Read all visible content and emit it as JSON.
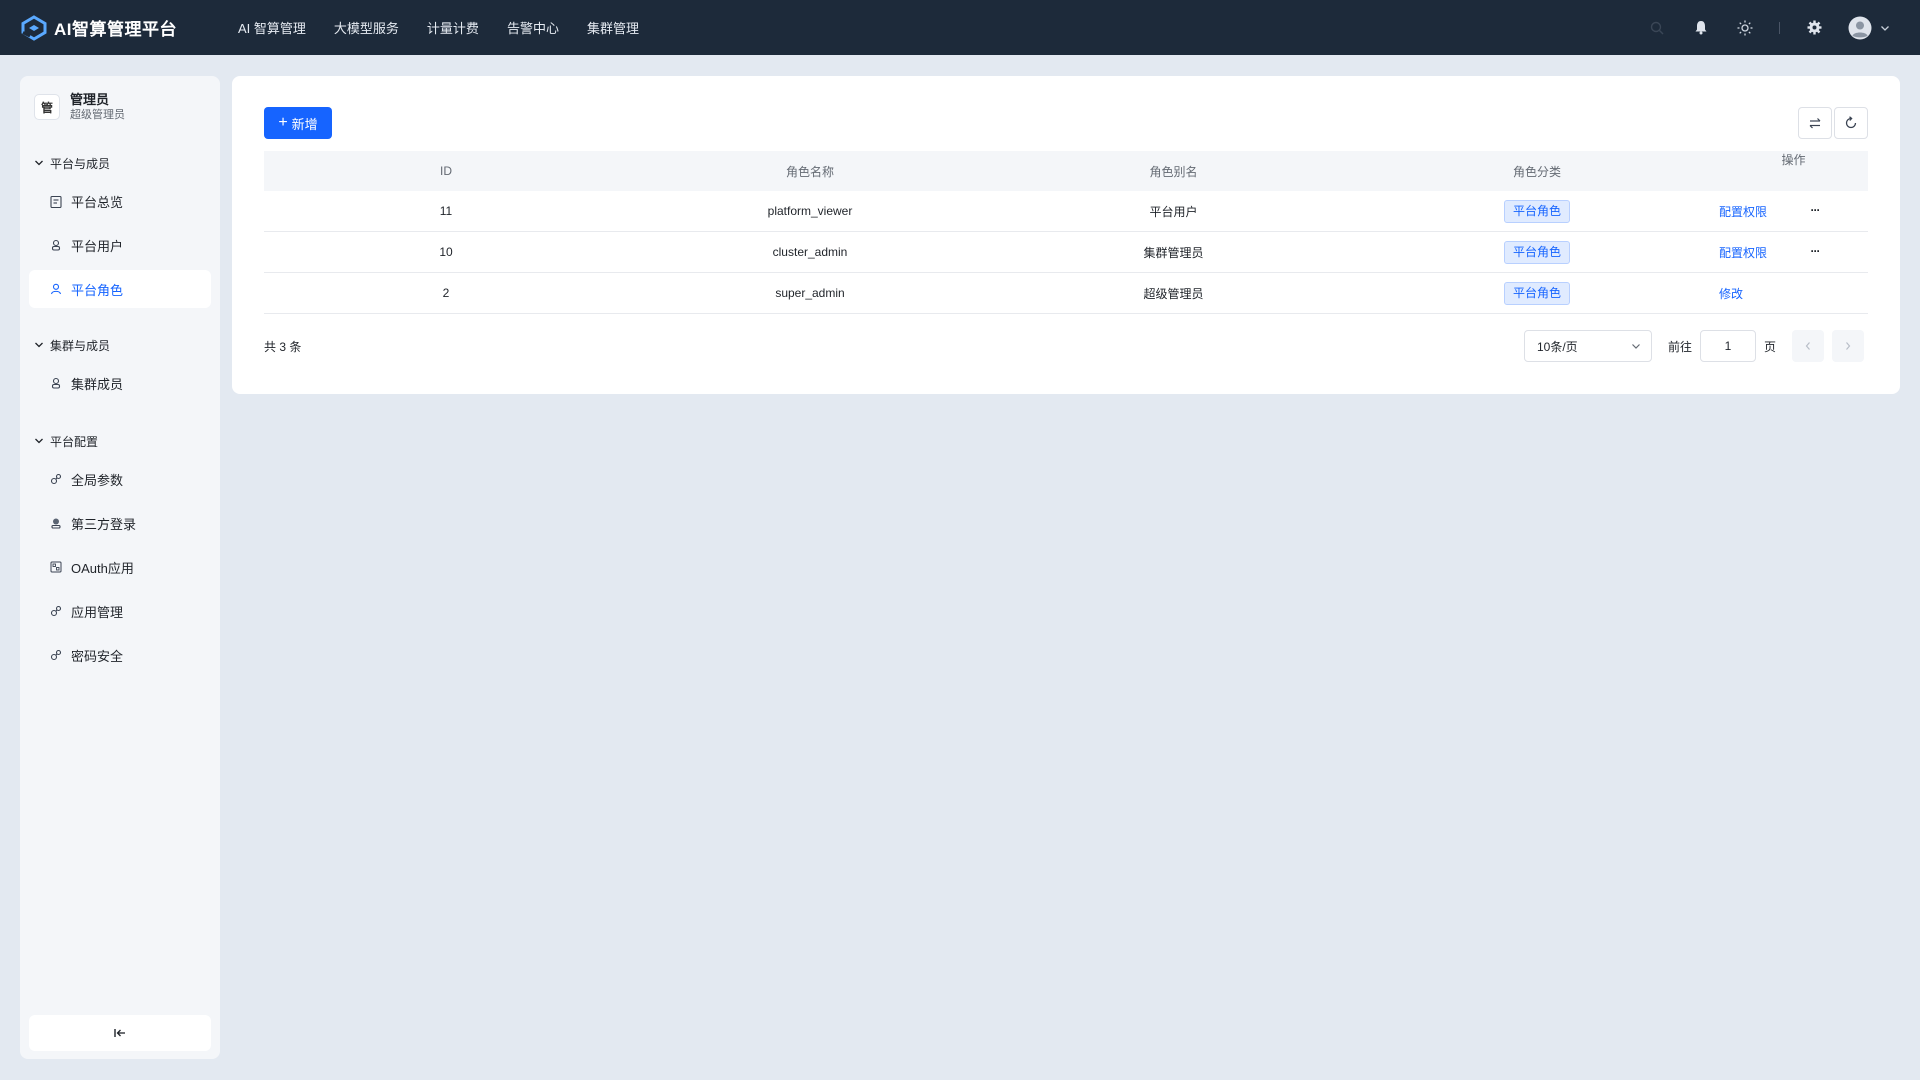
{
  "header": {
    "app_name": "AI智算管理平台",
    "nav": [
      {
        "label": "AI 智算管理"
      },
      {
        "label": "大模型服务"
      },
      {
        "label": "计量计费"
      },
      {
        "label": "告警中心"
      },
      {
        "label": "集群管理"
      }
    ]
  },
  "user": {
    "avatar_char": "管",
    "name": "管理员",
    "role": "超级管理员"
  },
  "sidebar": {
    "groups": [
      {
        "title": "平台与成员",
        "items": [
          {
            "label": "平台总览",
            "icon": "clipboard-icon"
          },
          {
            "label": "平台用户",
            "icon": "user-icon"
          },
          {
            "label": "平台角色",
            "icon": "role-icon",
            "active": true
          }
        ]
      },
      {
        "title": "集群与成员",
        "items": [
          {
            "label": "集群成员",
            "icon": "user-icon"
          }
        ]
      },
      {
        "title": "平台配置",
        "items": [
          {
            "label": "全局参数",
            "icon": "link-icon"
          },
          {
            "label": "第三方登录",
            "icon": "badge-icon"
          },
          {
            "label": "OAuth应用",
            "icon": "app-icon"
          },
          {
            "label": "应用管理",
            "icon": "link-icon"
          },
          {
            "label": "密码安全",
            "icon": "link-icon"
          }
        ]
      }
    ]
  },
  "toolbar": {
    "add_label": "新增"
  },
  "table": {
    "headers": {
      "id": "ID",
      "name": "角色名称",
      "alias": "角色别名",
      "category": "角色分类",
      "ops": "操作"
    },
    "rows": [
      {
        "id": "11",
        "name": "platform_viewer",
        "alias": "平台用户",
        "category": "平台角色",
        "op": "配置权限",
        "more": "···"
      },
      {
        "id": "10",
        "name": "cluster_admin",
        "alias": "集群管理员",
        "category": "平台角色",
        "op": "配置权限",
        "more": "···"
      },
      {
        "id": "2",
        "name": "super_admin",
        "alias": "超级管理员",
        "category": "平台角色",
        "op": "修改",
        "more": ""
      }
    ]
  },
  "pagination": {
    "total": "共 3 条",
    "page_size": "10条/页",
    "goto_label": "前往",
    "page_value": "1",
    "page_unit": "页"
  },
  "colors": {
    "primary": "#1664ff",
    "topbar": "#1d2a3a",
    "page_bg": "#e3e9f1"
  }
}
